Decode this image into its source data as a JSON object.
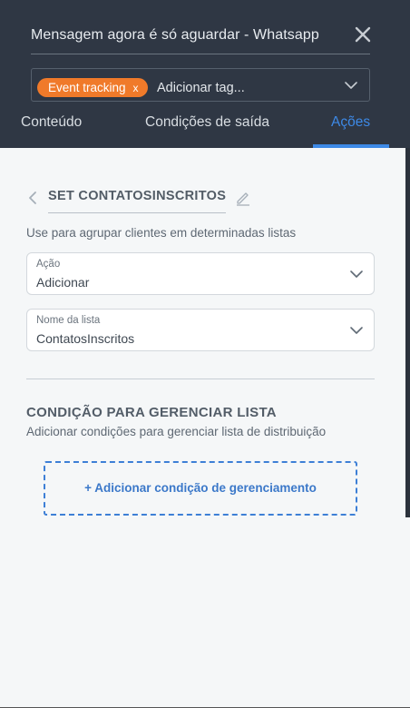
{
  "header": {
    "title": "Mensagem agora é só aguardar - Whatsapp",
    "close_icon": "close-icon"
  },
  "tags": {
    "chip_label": "Event tracking",
    "chip_remove": "x",
    "input_placeholder": "Adicionar tag..."
  },
  "tabs": [
    {
      "label": "Conteúdo",
      "active": false
    },
    {
      "label": "Condições de saída",
      "active": false
    },
    {
      "label": "Ações",
      "active": true
    }
  ],
  "action": {
    "name": "SET CONTATOSINSCRITOS",
    "description": "Use para agrupar clientes em determinadas listas",
    "fields": [
      {
        "label": "Ação",
        "value": "Adicionar"
      },
      {
        "label": "Nome da lista",
        "value": "ContatosInscritos"
      }
    ]
  },
  "condition": {
    "title": "CONDIÇÃO PARA GERENCIAR LISTA",
    "description": "Adicionar condições para gerenciar lista de distribuição",
    "add_button": "+ Adicionar condição de gerenciamento"
  },
  "colors": {
    "header_bg": "#2f3744",
    "accent": "#3d89e6",
    "tag": "#f07a2a"
  }
}
